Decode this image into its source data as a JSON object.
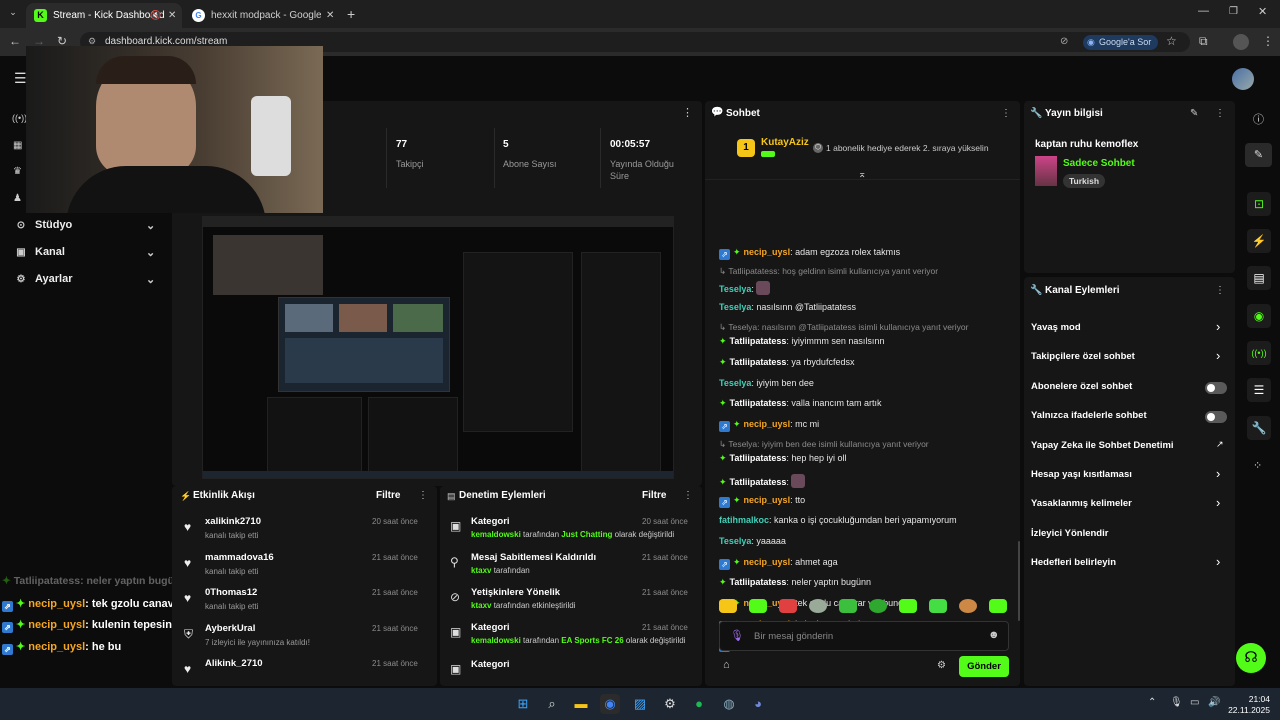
{
  "browser": {
    "tabs": [
      {
        "title": "Stream - Kick Dashboard"
      },
      {
        "title": "hexxit modpack - Google'da Ar"
      }
    ],
    "url": "dashboard.kick.com/stream",
    "google_sor": "Google'a Sor"
  },
  "sidebar": {
    "items": [
      {
        "label": "Stüdyo"
      },
      {
        "label": "Kanal"
      },
      {
        "label": "Ayarlar"
      }
    ]
  },
  "stats": [
    {
      "value": "77",
      "label": "Takipçi"
    },
    {
      "value": "5",
      "label": "Abone Sayısı"
    },
    {
      "value": "00:05:57",
      "label": "Yayında Olduğu Süre"
    }
  ],
  "overlay": {
    "lines": [
      {
        "user": "Tatliipatatess",
        "text": ": neler yaptın bugünn"
      },
      {
        "user": "necip_uysl",
        "text": ": tek gzolu canavar var bunda"
      },
      {
        "user": "necip_uysl",
        "text": ": kulenin tepesinde"
      },
      {
        "user": "necip_uysl",
        "text": ": he bu"
      }
    ]
  },
  "activity": {
    "title": "Etkinlik Akışı",
    "filter": "Filtre",
    "items": [
      {
        "name": "xalikink2710",
        "desc": "kanalı takip etti",
        "time": "20 saat önce"
      },
      {
        "name": "mammadova16",
        "desc": "kanalı takip etti",
        "time": "21 saat önce"
      },
      {
        "name": "0Thomas12",
        "desc": "kanalı takip etti",
        "time": "21 saat önce"
      },
      {
        "name": "AyberkUral",
        "desc": "7 izleyici ile yayınınıza katıldı!",
        "time": "21 saat önce"
      },
      {
        "name": "Alikink_2710",
        "desc": "",
        "time": "21 saat önce"
      }
    ]
  },
  "moderation": {
    "title": "Denetim Eylemleri",
    "filter": "Filtre",
    "items": [
      {
        "title": "Kategori",
        "actor": "kemaldowski",
        "mid": " tarafından ",
        "target": "Just Chatting",
        "tail": " olarak değiştirildi",
        "time": "20 saat önce"
      },
      {
        "title": "Mesaj Sabitlemesi Kaldırıldı",
        "actor": "ktaxv",
        "mid": " tarafından",
        "target": "",
        "tail": "",
        "time": "21 saat önce"
      },
      {
        "title": "Yetişkinlere Yönelik",
        "actor": "ktaxv",
        "mid": " tarafından etkinleştirildi",
        "target": "",
        "tail": "",
        "time": "21 saat önce"
      },
      {
        "title": "Kategori",
        "actor": "kemaldowski",
        "mid": " tarafından ",
        "target": "EA Sports FC 26",
        "tail": " olarak değiştirildi",
        "time": "21 saat önce"
      },
      {
        "title": "Kategori",
        "actor": "",
        "mid": "",
        "target": "",
        "tail": "",
        "time": ""
      }
    ]
  },
  "chat": {
    "title": "Sohbet",
    "pinned_user": "KutayAziz",
    "pinned_count": "1",
    "gift_text": "1 abonelik hediye ederek 2. sıraya yükselin",
    "messages": [
      {
        "type": "msg",
        "user": "necip_uysl",
        "color": "#f5a623",
        "text": "adam egzoza rolex takmıs"
      },
      {
        "type": "sys",
        "text": "Tatliipatatess: hoş geldinn isimli kullanıcıya yanıt veriyor"
      },
      {
        "type": "msg",
        "user": "Teselya",
        "color": "#3fd0b8",
        "text": ""
      },
      {
        "type": "msg",
        "user": "Teselya",
        "color": "#3fd0b8",
        "text": "nasılsınn @Tatliipatatess"
      },
      {
        "type": "sys",
        "text": "Teselya: nasılsınn @Tatliipatatess isimli kullanıcıya yanıt veriyor"
      },
      {
        "type": "msg",
        "user": "Tatliipatatess",
        "color": "#ffffff",
        "text": "iyiyimmm sen nasılsınn"
      },
      {
        "type": "msg",
        "user": "Tatliipatatess",
        "color": "#ffffff",
        "text": "ya rbydufcfedsx"
      },
      {
        "type": "msg",
        "user": "Teselya",
        "color": "#3fd0b8",
        "text": "iyiyim ben dee"
      },
      {
        "type": "msg",
        "user": "Tatliipatatess",
        "color": "#ffffff",
        "text": "valla inancım tam artık"
      },
      {
        "type": "msg",
        "user": "necip_uysl",
        "color": "#f5a623",
        "text": "mc mi"
      },
      {
        "type": "sys",
        "text": "Teselya: iyiyim ben dee isimli kullanıcıya yanıt veriyor"
      },
      {
        "type": "msg",
        "user": "Tatliipatatess",
        "color": "#ffffff",
        "text": "hep hep iyi oll"
      },
      {
        "type": "msg",
        "user": "Tatliipatatess",
        "color": "#ffffff",
        "text": ""
      },
      {
        "type": "msg",
        "user": "necip_uysl",
        "color": "#f5a623",
        "text": "tto"
      },
      {
        "type": "msg",
        "user": "fatihmalkoc",
        "color": "#3fd0b8",
        "text": "kanka o işi çocukluğumdan beri yapamıyorum"
      },
      {
        "type": "msg",
        "user": "Teselya",
        "color": "#3fd0b8",
        "text": "yaaaaa"
      },
      {
        "type": "msg",
        "user": "necip_uysl",
        "color": "#f5a623",
        "text": "ahmet aga"
      },
      {
        "type": "msg",
        "user": "Tatliipatatess",
        "color": "#ffffff",
        "text": "neler yaptın bugünn"
      },
      {
        "type": "msg",
        "user": "necip_uysl",
        "color": "#f5a623",
        "text": "tek gzolu canavar var bunda"
      },
      {
        "type": "msg",
        "user": "necip_uysl",
        "color": "#f5a623",
        "text": "kulenin tepesinde"
      },
      {
        "type": "msg",
        "user": "necip_uysl",
        "color": "#f5a623",
        "text": "he bu"
      }
    ],
    "input_placeholder": "Bir mesaj gönderin",
    "send_label": "Gönder"
  },
  "stream_info": {
    "title": "Yayın bilgisi",
    "stream_title": "kaptan ruhu kemoflex",
    "category": "Sadece Sohbet",
    "tag": "Turkish"
  },
  "channel_actions": {
    "title": "Kanal Eylemleri",
    "items": [
      {
        "label": "Yavaş mod",
        "ctrl": "arrow"
      },
      {
        "label": "Takipçilere özel sohbet",
        "ctrl": "arrow"
      },
      {
        "label": "Abonelere özel sohbet",
        "ctrl": "toggle"
      },
      {
        "label": "Yalnızca ifadelerle sohbet",
        "ctrl": "toggle"
      },
      {
        "label": "Yapay Zeka ile Sohbet Denetimi",
        "ctrl": "ext"
      },
      {
        "label": "Hesap yaşı kısıtlaması",
        "ctrl": "arrow"
      },
      {
        "label": "Yasaklanmış kelimeler",
        "ctrl": "arrow"
      },
      {
        "label": "İzleyici Yönlendir",
        "ctrl": "none"
      },
      {
        "label": "Hedefleri belirleyin",
        "ctrl": "arrow"
      }
    ]
  },
  "taskbar": {
    "time": "21:04",
    "date": "22.11.2025"
  },
  "colors": {
    "accent": "#53fc18",
    "background": "#0c0c0c",
    "panel": "#161616"
  }
}
